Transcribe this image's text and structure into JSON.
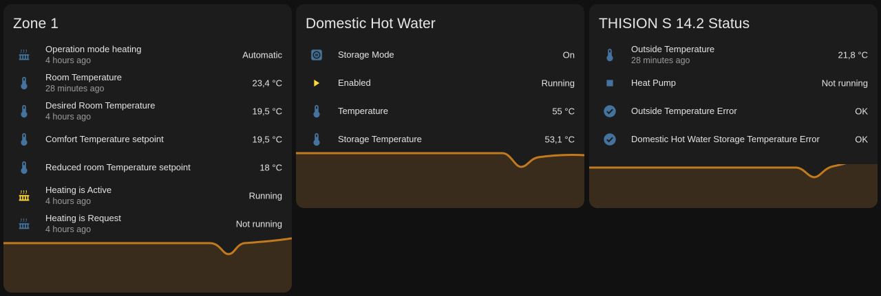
{
  "colors": {
    "background": "#111111",
    "card": "#1c1c1c",
    "icon_blue": "#44739e",
    "icon_active": "#fdd835",
    "graph_line": "#c27a1e",
    "graph_fill": "#3a2c1c"
  },
  "zone1": {
    "title": "Zone 1",
    "rows": [
      {
        "icon": "radiator-icon",
        "name": "Operation mode heating",
        "sub": "4 hours ago",
        "state": "Automatic"
      },
      {
        "icon": "thermometer-icon",
        "name": "Room Temperature",
        "sub": "28 minutes ago",
        "state": "23,4 °C"
      },
      {
        "icon": "thermometer-icon",
        "name": "Desired Room Temperature",
        "sub": "4 hours ago",
        "state": "19,5 °C"
      },
      {
        "icon": "thermometer-icon",
        "name": "Comfort Temperature setpoint",
        "sub": "",
        "state": "19,5 °C"
      },
      {
        "icon": "thermometer-icon",
        "name": "Reduced room Temperature setpoint",
        "sub": "",
        "state": "18 °C"
      },
      {
        "icon": "radiator-active-icon",
        "name": "Heating is Active",
        "sub": "4 hours ago",
        "state": "Running"
      },
      {
        "icon": "radiator-icon",
        "name": "Heating is Request",
        "sub": "4 hours ago",
        "state": "Not running"
      }
    ]
  },
  "dhw": {
    "title": "Domestic Hot Water",
    "rows": [
      {
        "icon": "storage-icon",
        "name": "Storage Mode",
        "sub": "",
        "state": "On"
      },
      {
        "icon": "play-icon",
        "name": "Enabled",
        "sub": "",
        "state": "Running"
      },
      {
        "icon": "thermometer-icon",
        "name": "Temperature",
        "sub": "",
        "state": "55 °C"
      },
      {
        "icon": "thermometer-icon",
        "name": "Storage Temperature",
        "sub": "",
        "state": "53,1 °C"
      }
    ]
  },
  "thision": {
    "title": "THISION S 14.2 Status",
    "rows": [
      {
        "icon": "thermometer-icon",
        "name": "Outside Temperature",
        "sub": "28 minutes ago",
        "state": "21,8 °C"
      },
      {
        "icon": "stop-icon",
        "name": "Heat Pump",
        "sub": "",
        "state": "Not running"
      },
      {
        "icon": "check-circle-icon",
        "name": "Outside Temperature Error",
        "sub": "",
        "state": "OK"
      },
      {
        "icon": "check-circle-icon",
        "name": "Domestic Hot Water Storage Temperature Error",
        "sub": "",
        "state": "OK"
      }
    ]
  }
}
